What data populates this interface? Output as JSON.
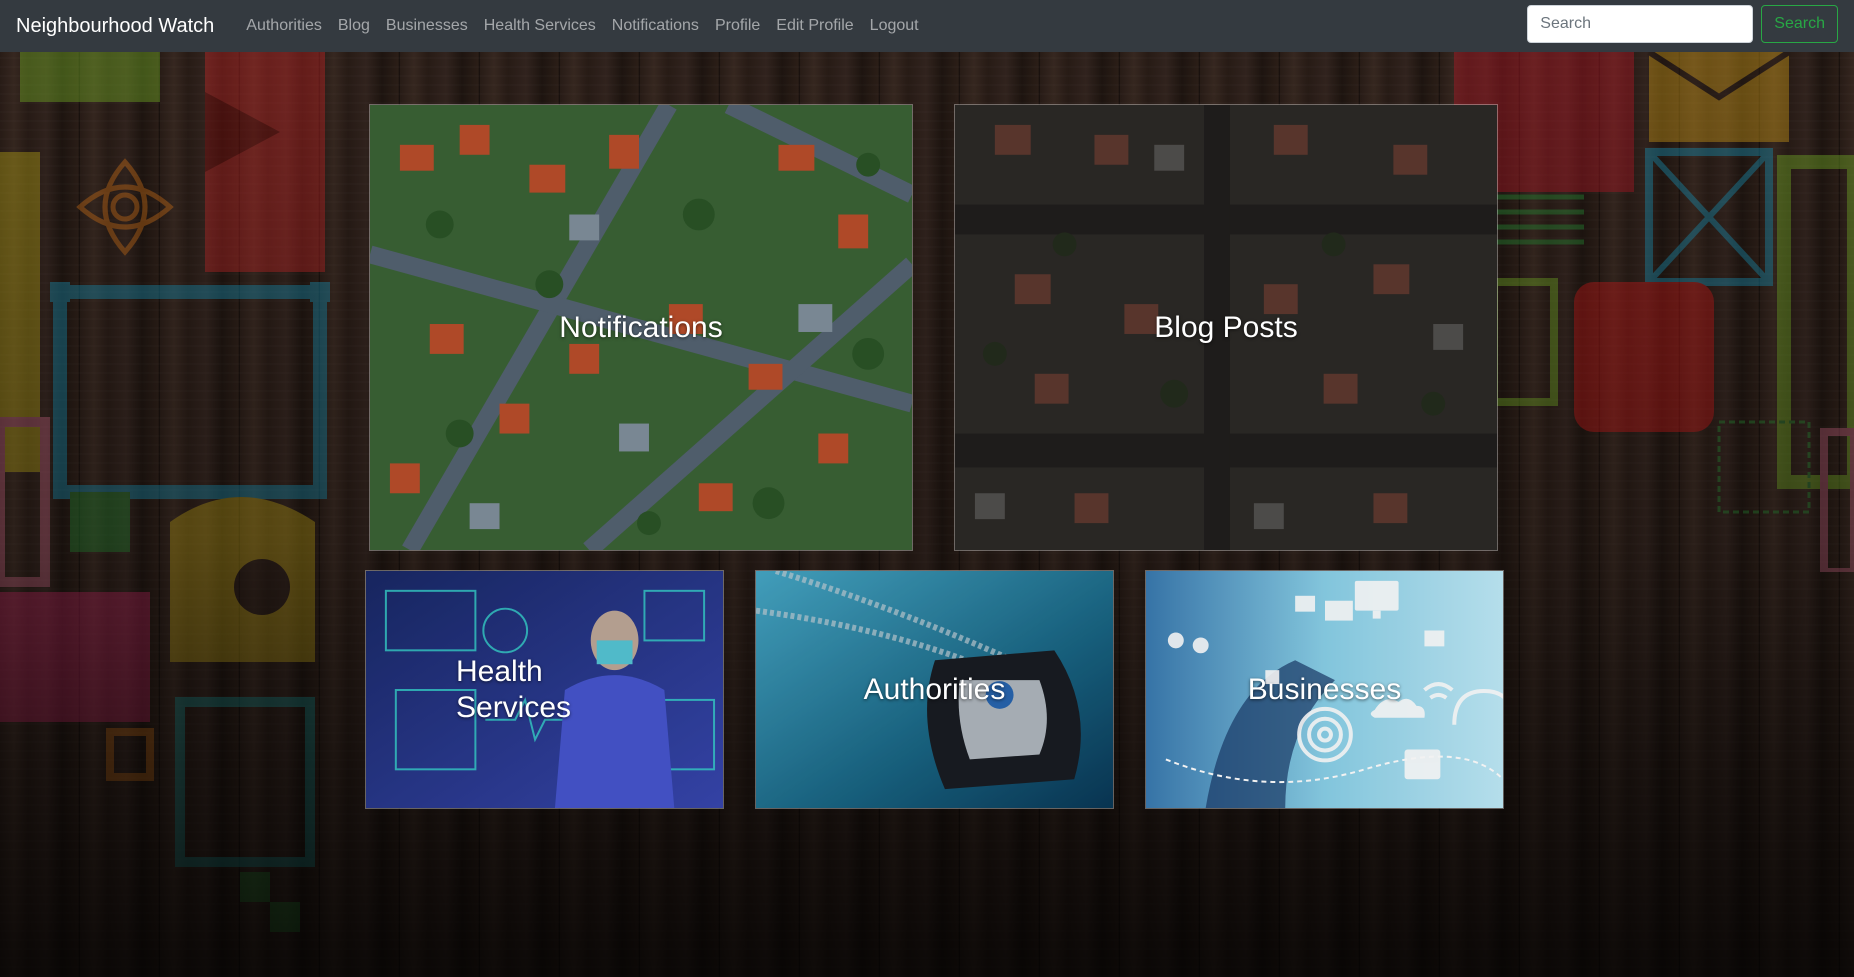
{
  "navbar": {
    "brand": "Neighbourhood Watch",
    "links": [
      "Authorities",
      "Blog",
      "Businesses",
      "Health Services",
      "Notifications",
      "Profile",
      "Edit Profile",
      "Logout"
    ],
    "search_placeholder": "Search",
    "search_button": "Search"
  },
  "tiles": {
    "notifications": "Notifications",
    "blog": "Blog Posts",
    "health": "Health Services",
    "authorities": "Authorities",
    "businesses": "Businesses"
  },
  "colors": {
    "navbar_bg": "#343a40",
    "search_accent": "#28a745",
    "nav_link": "rgba(255,255,255,0.55)"
  }
}
